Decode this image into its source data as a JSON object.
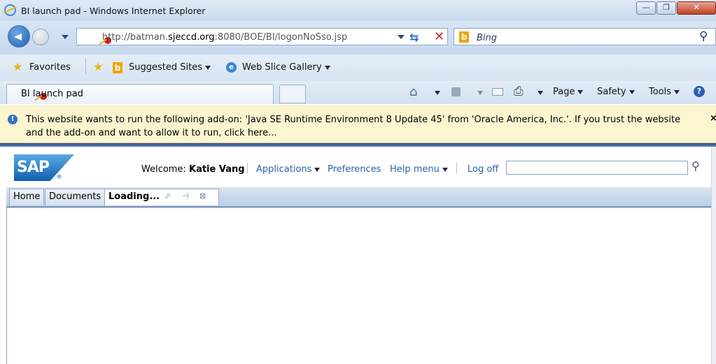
{
  "window": {
    "title": "BI launch pad - Windows Internet Explorer"
  },
  "address_bar": {
    "url_prefix": "http://batman.",
    "url_domain": "sjeccd.org",
    "url_suffix": ":8080/BOE/BI/logonNoSso.jsp"
  },
  "search": {
    "placeholder": "Bing"
  },
  "favorites_bar": {
    "favorites_label": "Favorites",
    "suggested_sites_label": "Suggested Sites",
    "web_slice_gallery_label": "Web Slice Gallery"
  },
  "tabs": {
    "active_tab_label": "BI launch pad"
  },
  "command_bar": {
    "page_label": "Page",
    "safety_label": "Safety",
    "tools_label": "Tools"
  },
  "info_bar": {
    "message": "This website wants to run the following add-on: 'Java SE Runtime Environment 8 Update 45' from 'Oracle America, Inc.'. If you trust the website and the add-on and want to allow it to run, click here...",
    "close_glyph": "×"
  },
  "sap_header": {
    "logo_text": "SAP",
    "welcome_prefix": "Welcome:",
    "user_name": "Katie Vang",
    "applications_label": "Applications",
    "preferences_label": "Preferences",
    "help_menu_label": "Help menu",
    "log_off_label": "Log off"
  },
  "sap_tabs": {
    "home_label": "Home",
    "documents_label": "Documents",
    "loading_label": "Loading..."
  },
  "icons": {
    "back": "back-arrow-icon",
    "forward": "forward-arrow-icon",
    "refresh": "refresh-icon",
    "stop": "stop-icon",
    "search": "magnifier-icon",
    "home": "home-icon",
    "feeds": "feeds-icon",
    "mail": "mail-icon",
    "print": "printer-icon",
    "help": "help-icon"
  },
  "colors": {
    "info_bar_bg": "#fbf6cf",
    "sap_link": "#2a62a8",
    "sap_blue": "#1260b0"
  }
}
